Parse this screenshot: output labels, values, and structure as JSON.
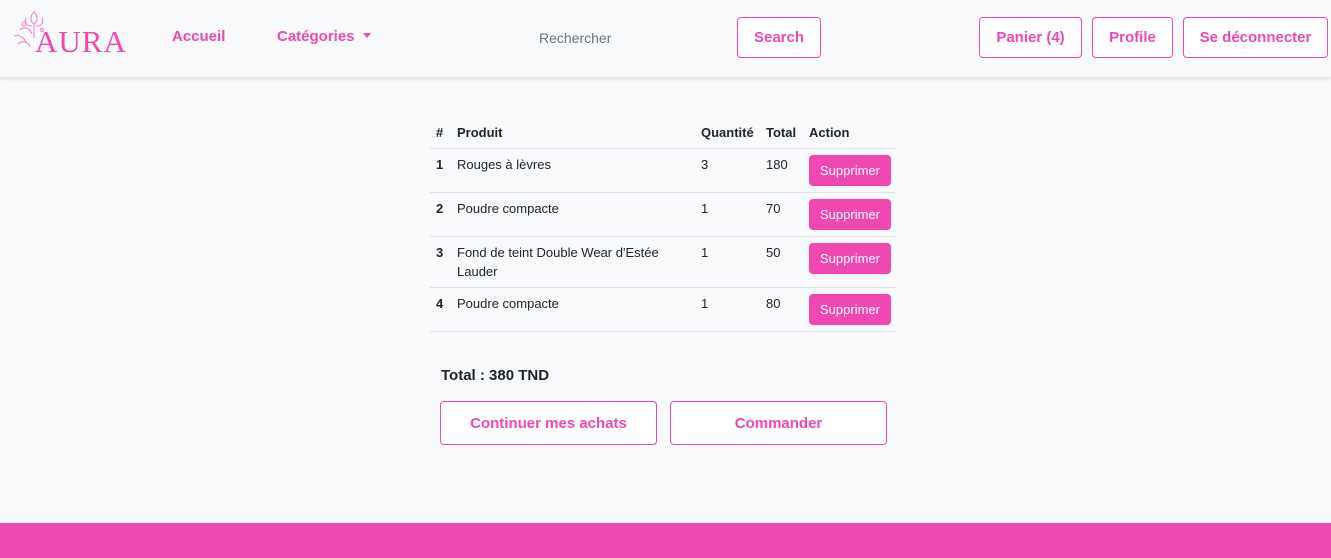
{
  "brand": {
    "name": "AURA",
    "color": "#ef48b0"
  },
  "nav": {
    "home": "Accueil",
    "categories": "Catégories",
    "search_placeholder": "Rechercher",
    "search_button": "Search",
    "cart": "Panier (4)",
    "profile": "Profile",
    "logout": "Se déconnecter"
  },
  "cart": {
    "headers": {
      "num": "#",
      "product": "Produit",
      "qty": "Quantité",
      "total": "Total",
      "action": "Action"
    },
    "rows": [
      {
        "num": "1",
        "product": "Rouges à lèvres",
        "qty": "3",
        "total": "180",
        "action": "Supprimer"
      },
      {
        "num": "2",
        "product": "Poudre compacte",
        "qty": "1",
        "total": "70",
        "action": "Supprimer"
      },
      {
        "num": "3",
        "product": "Fond de teint Double Wear d'Estée Lauder",
        "qty": "1",
        "total": "50",
        "action": "Supprimer"
      },
      {
        "num": "4",
        "product": "Poudre compacte",
        "qty": "1",
        "total": "80",
        "action": "Supprimer"
      }
    ],
    "total_label": "Total : 380 TND",
    "continue_button": "Continuer mes achats",
    "order_button": "Commander"
  }
}
